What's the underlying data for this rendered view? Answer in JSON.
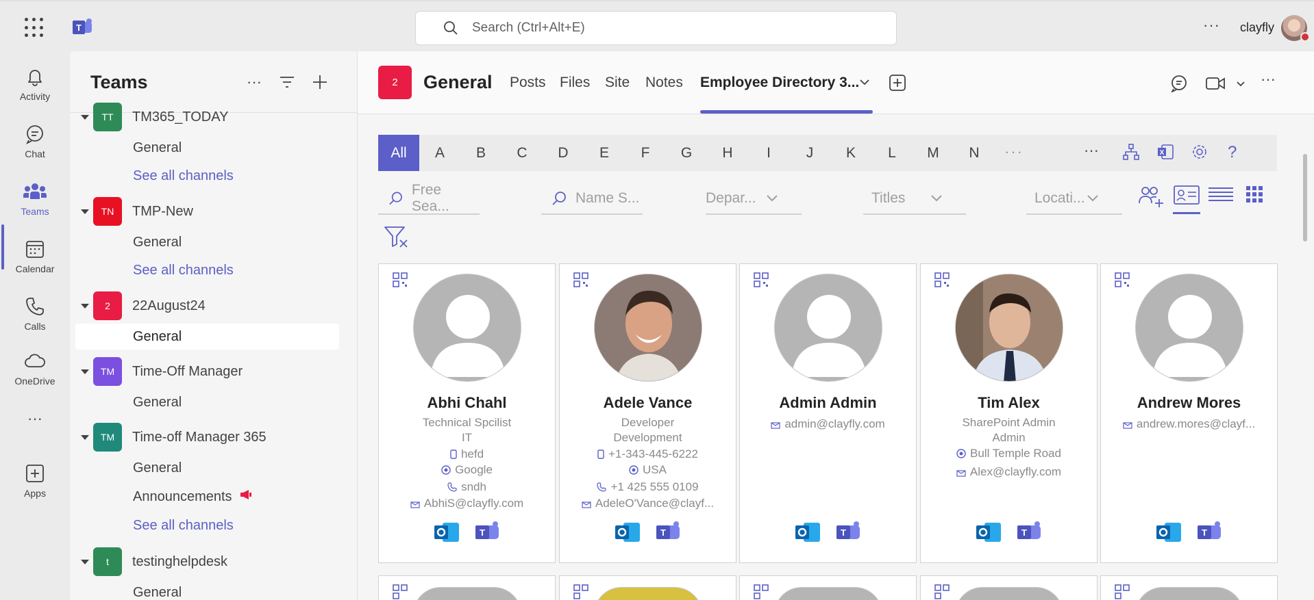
{
  "topbar": {
    "search_placeholder": "Search (Ctrl+Alt+E)",
    "more_label": "···",
    "user_name": "clayfly"
  },
  "rail": {
    "items": [
      {
        "label": "Activity",
        "icon": "bell-icon"
      },
      {
        "label": "Chat",
        "icon": "chat-icon"
      },
      {
        "label": "Teams",
        "icon": "teams-icon"
      },
      {
        "label": "Calendar",
        "icon": "calendar-icon"
      },
      {
        "label": "Calls",
        "icon": "phone-icon"
      },
      {
        "label": "OneDrive",
        "icon": "cloud-icon"
      },
      {
        "label": "···",
        "icon": "more-icon"
      },
      {
        "label": "Apps",
        "icon": "apps-icon"
      }
    ]
  },
  "teams_panel": {
    "title": "Teams",
    "teams": [
      {
        "initials": "TT",
        "name": "TM365_TODAY",
        "color": "#2e8b57",
        "channels": [
          "General",
          "See all channels"
        ]
      },
      {
        "initials": "TN",
        "name": "TMP-New",
        "color": "#e81123",
        "channels": [
          "General",
          "See all channels"
        ]
      },
      {
        "initials": "2",
        "name": "22August24",
        "color": "#e81c44",
        "channels": [
          "General"
        ]
      },
      {
        "initials": "TM",
        "name": "Time-Off Manager",
        "color": "#7b4fe0",
        "channels": [
          "General"
        ]
      },
      {
        "initials": "TM",
        "name": "Time-off Manager 365",
        "color": "#1f8a7a",
        "channels": [
          "General",
          "Announcements",
          "See all channels"
        ]
      },
      {
        "initials": "t",
        "name": "testinghelpdesk",
        "color": "#2e8b57",
        "channels": [
          "General"
        ]
      }
    ]
  },
  "channel": {
    "avatar": "2",
    "title": "General",
    "tabs": [
      "Posts",
      "Files",
      "Site",
      "Notes",
      "Employee Directory 3..."
    ]
  },
  "directory": {
    "alphabet": [
      "All",
      "A",
      "B",
      "C",
      "D",
      "E",
      "F",
      "G",
      "H",
      "I",
      "J",
      "K",
      "L",
      "M",
      "N"
    ],
    "alpha_more": "···",
    "filters": {
      "free_search": "Free Sea...",
      "name_search": "Name S...",
      "department": "Depar...",
      "titles": "Titles",
      "location": "Locati..."
    },
    "employees": [
      {
        "name": "Abhi Chahl",
        "title": "Technical Spcilist",
        "department": "IT",
        "mobile": "hefd",
        "location": "Google",
        "phone": "sndh",
        "email": "AbhiS@clayfly.com",
        "photo": "placeholder"
      },
      {
        "name": "Adele Vance",
        "title": "Developer",
        "department": "Development",
        "mobile": "+1-343-445-6222",
        "location": "USA",
        "phone": "+1 425 555 0109",
        "email": "AdeleO'Vance@clayf...",
        "photo": "man-smiling"
      },
      {
        "name": "Admin Admin",
        "email": "admin@clayfly.com",
        "photo": "placeholder"
      },
      {
        "name": "Tim Alex",
        "title": "SharePoint Admin",
        "department": "Admin",
        "location": "Bull Temple Road",
        "email": "Alex@clayfly.com",
        "photo": "man-suit"
      },
      {
        "name": "Andrew Mores",
        "email": "andrew.mores@clayf...",
        "photo": "placeholder"
      }
    ]
  },
  "colors": {
    "accent": "#5b5fc7",
    "channel_red": "#e81c44"
  }
}
